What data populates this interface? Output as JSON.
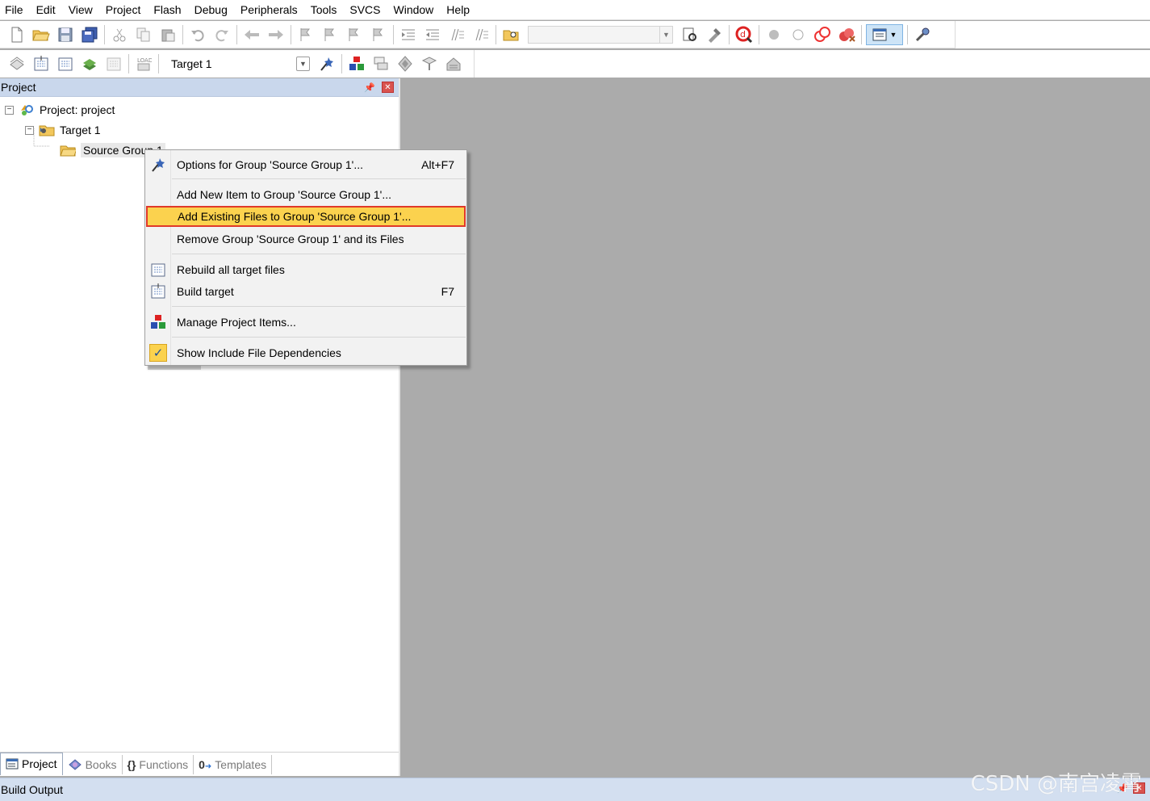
{
  "menubar": {
    "items": [
      "File",
      "Edit",
      "View",
      "Project",
      "Flash",
      "Debug",
      "Peripherals",
      "Tools",
      "SVCS",
      "Window",
      "Help"
    ]
  },
  "toolbar2": {
    "target_value": "Target 1"
  },
  "project_panel": {
    "title": "Project",
    "tree": {
      "project_label": "Project: project",
      "target_label": "Target 1",
      "group_label": "Source Group 1"
    },
    "tabs": [
      {
        "label": "Project",
        "icon": "project-tab-icon"
      },
      {
        "label": "Books",
        "icon": "books-icon"
      },
      {
        "label": "Functions",
        "icon": "functions-icon"
      },
      {
        "label": "Templates",
        "icon": "templates-icon"
      }
    ]
  },
  "context_menu": {
    "items": [
      {
        "label": "Options for Group 'Source Group 1'...",
        "shortcut": "Alt+F7",
        "icon": "options-wand-icon"
      },
      {
        "label": "Add New  Item to Group 'Source Group 1'...",
        "shortcut": "",
        "icon": ""
      },
      {
        "label": "Add Existing Files to Group 'Source Group 1'...",
        "shortcut": "",
        "icon": "",
        "highlighted": true
      },
      {
        "label": "Remove Group 'Source Group 1' and its Files",
        "shortcut": "",
        "icon": ""
      },
      {
        "label": "Rebuild all target files",
        "shortcut": "",
        "icon": "rebuild-icon"
      },
      {
        "label": "Build target",
        "shortcut": "F7",
        "icon": "build-icon"
      },
      {
        "label": "Manage Project Items...",
        "shortcut": "",
        "icon": "manage-items-icon"
      },
      {
        "label": "Show Include File Dependencies",
        "shortcut": "",
        "icon": "checkmark-icon",
        "checked": true
      }
    ]
  },
  "build_output": {
    "title": "Build Output"
  },
  "watermark": "CSDN @南宫凌霄",
  "colors": {
    "highlight_bg": "#fbd24e",
    "highlight_border": "#e0392a",
    "panel_header": "#c9d7ec",
    "editor_bg": "#ababab"
  }
}
